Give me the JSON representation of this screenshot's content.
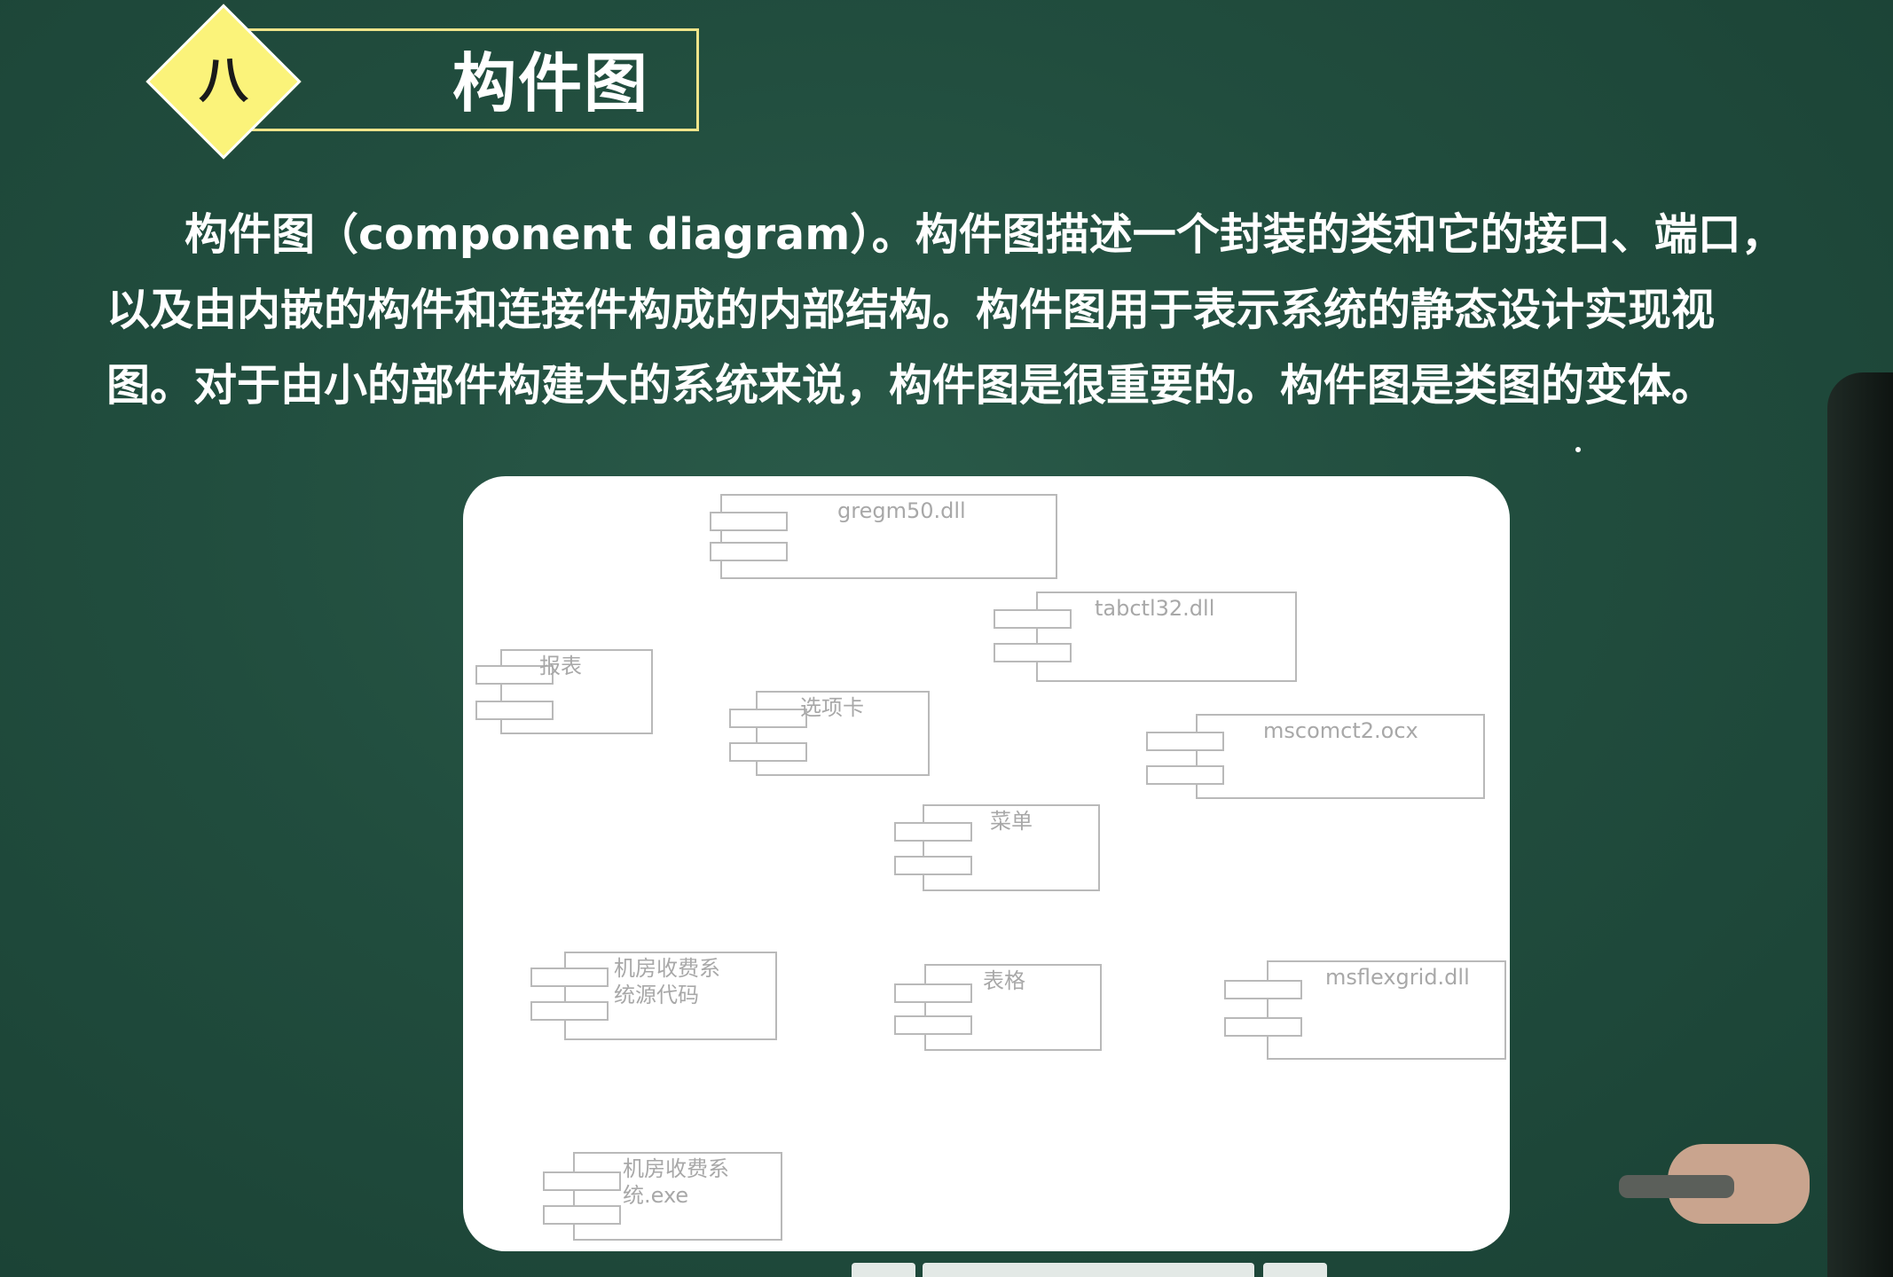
{
  "slide": {
    "badge": "八",
    "title": "构件图",
    "paragraph_lines": [
      "构件图（component diagram）。构件图描述一个封装的类和它的接口、端口，",
      "以及由内嵌的构件和连接件构成的内部结构。构件图用于表示系统的静态设计实现视",
      "图。对于由小的部件构建大的系统来说，构件图是很重要的。构件图是类图的变体。"
    ]
  },
  "diagram": {
    "components": [
      {
        "id": "gregm50",
        "label": "gregm50.dll"
      },
      {
        "id": "tabctl32",
        "label": "tabctl32.dll"
      },
      {
        "id": "report",
        "label": "报表"
      },
      {
        "id": "options",
        "label": "选项卡"
      },
      {
        "id": "mscomctl2",
        "label": "mscomct2.ocx"
      },
      {
        "id": "menu",
        "label": "菜单"
      },
      {
        "id": "source",
        "label": "机房收费系\n统源代码"
      },
      {
        "id": "forms",
        "label": "表格"
      },
      {
        "id": "msflexgrid",
        "label": "msflexgrid.dll"
      },
      {
        "id": "exe",
        "label": "机房收费系\n统.exe"
      }
    ]
  },
  "colors": {
    "board": "#214d3e",
    "badge_fill": "#fbf37a",
    "title_frame": "#efe48a",
    "panel": "#ffffff",
    "component_stroke": "#b9b9b9"
  }
}
